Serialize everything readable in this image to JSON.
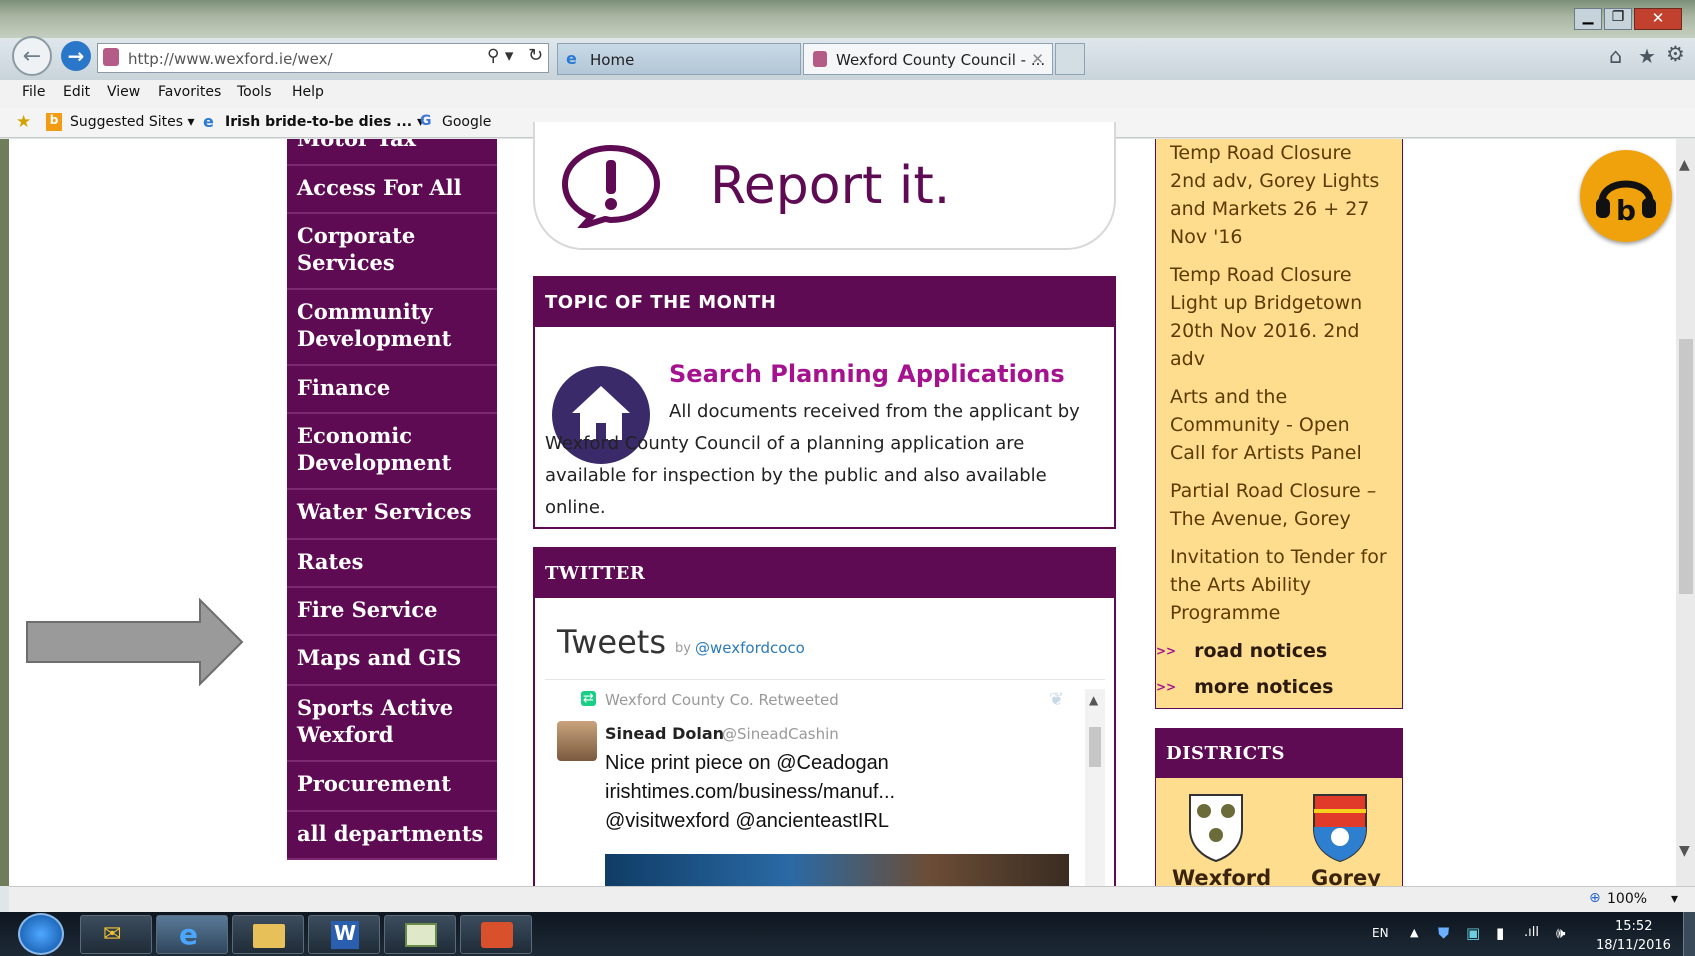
{
  "browser": {
    "url": "http://www.wexford.ie/wex/",
    "tabs": [
      {
        "label": "Home"
      },
      {
        "label": "Wexford County Council - ..."
      }
    ],
    "menu": [
      "File",
      "Edit",
      "View",
      "Favorites",
      "Tools",
      "Help"
    ],
    "favorites": [
      "Suggested Sites ▾",
      "Irish bride-to-be dies ... ▾",
      "Google"
    ],
    "zoom": "100%"
  },
  "sidebar": {
    "cut_label": "Motor Tax",
    "items": [
      "Access For All",
      "Corporate Services",
      "Community Development",
      "Finance",
      "Economic Development",
      "Water Services",
      "Rates",
      "Fire Service",
      "Maps and GIS",
      "Sports Active Wexford",
      "Procurement",
      "all departments"
    ]
  },
  "report": {
    "label": "Report it."
  },
  "topic": {
    "heading": "TOPIC OF THE MONTH",
    "link": "Search Planning Applications",
    "text": "All documents received from the applicant by Wexford County Council of a planning application are available for inspection by the public and also available online."
  },
  "twitter": {
    "heading": "TWITTER",
    "title": "Tweets",
    "by": "by",
    "handle": "@wexfordcoco",
    "retweet": "Wexford County Co. Retweeted",
    "author": "Sinead Dolan",
    "author_handle": "@SineadCashin",
    "tweet_lines": [
      "Nice print piece on @Ceadogan",
      "irishtimes.com/business/manuf...",
      "@visitwexford @ancienteastIRL"
    ]
  },
  "notices": {
    "items": [
      "Temp Road Closure 2nd adv, Gorey Lights and Markets 26 + 27 Nov '16",
      "Temp Road Closure Light up Bridgetown 20th Nov 2016. 2nd adv",
      "Arts and the Community - Open Call for Artists Panel",
      "Partial Road Closure – The Avenue, Gorey",
      "Invitation to Tender for the Arts Ability Programme"
    ],
    "links": [
      "road notices",
      "more notices"
    ]
  },
  "districts": {
    "heading": "DISTRICTS",
    "items": [
      "Wexford",
      "Gorey"
    ]
  },
  "taskbar": {
    "lang": "EN",
    "time": "15:52",
    "date": "18/11/2016"
  },
  "colors": {
    "purple": "#5e0b54",
    "link": "#a5128f",
    "notice_bg": "#ffdd8f",
    "accent_orange": "#f0a20c"
  }
}
